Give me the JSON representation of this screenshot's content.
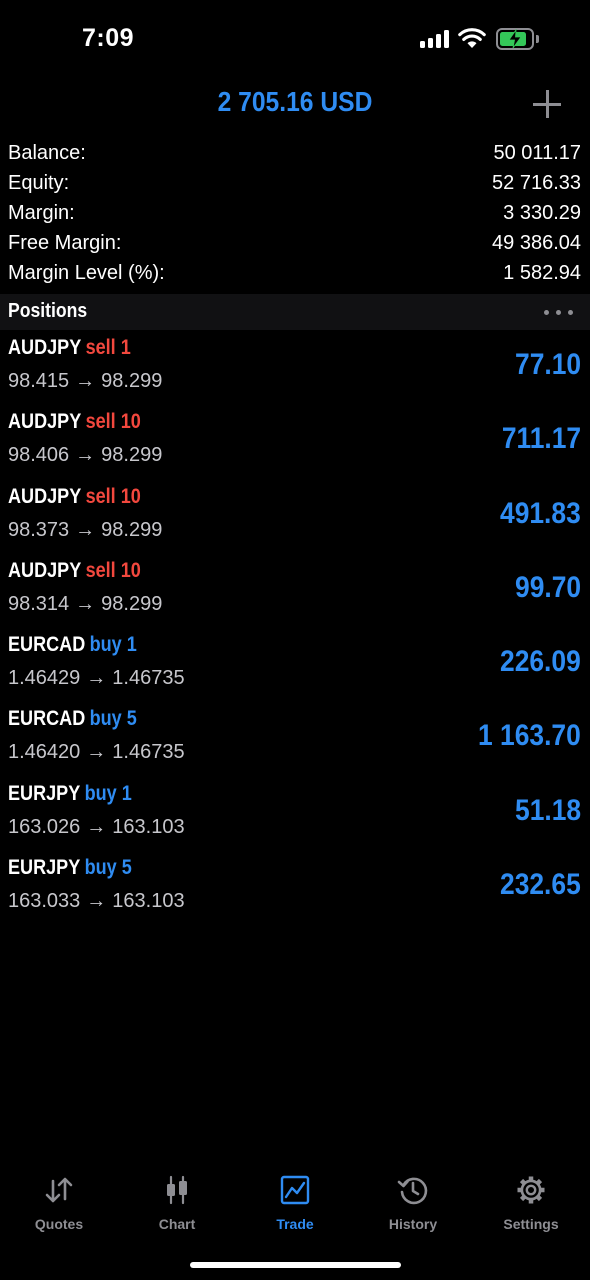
{
  "status_bar": {
    "time": "7:09"
  },
  "header": {
    "title": "2 705.16 USD"
  },
  "summary": [
    {
      "label": "Balance:",
      "value": "50 011.17"
    },
    {
      "label": "Equity:",
      "value": "52 716.33"
    },
    {
      "label": "Margin:",
      "value": "3 330.29"
    },
    {
      "label": "Free Margin:",
      "value": "49 386.04"
    },
    {
      "label": "Margin Level (%):",
      "value": "1 582.94"
    }
  ],
  "positions_section": {
    "title": "Positions"
  },
  "positions": [
    {
      "symbol": "AUDJPY",
      "side": "sell 1",
      "direction": "sell",
      "open": "98.415",
      "arrow": "→",
      "current": "98.299",
      "profit": "77.10"
    },
    {
      "symbol": "AUDJPY",
      "side": "sell 10",
      "direction": "sell",
      "open": "98.406",
      "arrow": "→",
      "current": "98.299",
      "profit": "711.17"
    },
    {
      "symbol": "AUDJPY",
      "side": "sell 10",
      "direction": "sell",
      "open": "98.373",
      "arrow": "→",
      "current": "98.299",
      "profit": "491.83"
    },
    {
      "symbol": "AUDJPY",
      "side": "sell 10",
      "direction": "sell",
      "open": "98.314",
      "arrow": "→",
      "current": "98.299",
      "profit": "99.70"
    },
    {
      "symbol": "EURCAD",
      "side": "buy 1",
      "direction": "buy",
      "open": "1.46429",
      "arrow": "→",
      "current": "1.46735",
      "profit": "226.09"
    },
    {
      "symbol": "EURCAD",
      "side": "buy 5",
      "direction": "buy",
      "open": "1.46420",
      "arrow": "→",
      "current": "1.46735",
      "profit": "1 163.70"
    },
    {
      "symbol": "EURJPY",
      "side": "buy 1",
      "direction": "buy",
      "open": "163.026",
      "arrow": "→",
      "current": "163.103",
      "profit": "51.18"
    },
    {
      "symbol": "EURJPY",
      "side": "buy 5",
      "direction": "buy",
      "open": "163.033",
      "arrow": "→",
      "current": "163.103",
      "profit": "232.65"
    }
  ],
  "tabs": [
    {
      "label": "Quotes",
      "icon": "quotes-icon",
      "active": false
    },
    {
      "label": "Chart",
      "icon": "chart-icon",
      "active": false
    },
    {
      "label": "Trade",
      "icon": "trade-icon",
      "active": true
    },
    {
      "label": "History",
      "icon": "history-icon",
      "active": false
    },
    {
      "label": "Settings",
      "icon": "settings-icon",
      "active": false
    }
  ],
  "colors": {
    "accent": "#2f8cf2",
    "sell": "#f2483e",
    "muted": "#8e8e93",
    "background": "#000000"
  }
}
